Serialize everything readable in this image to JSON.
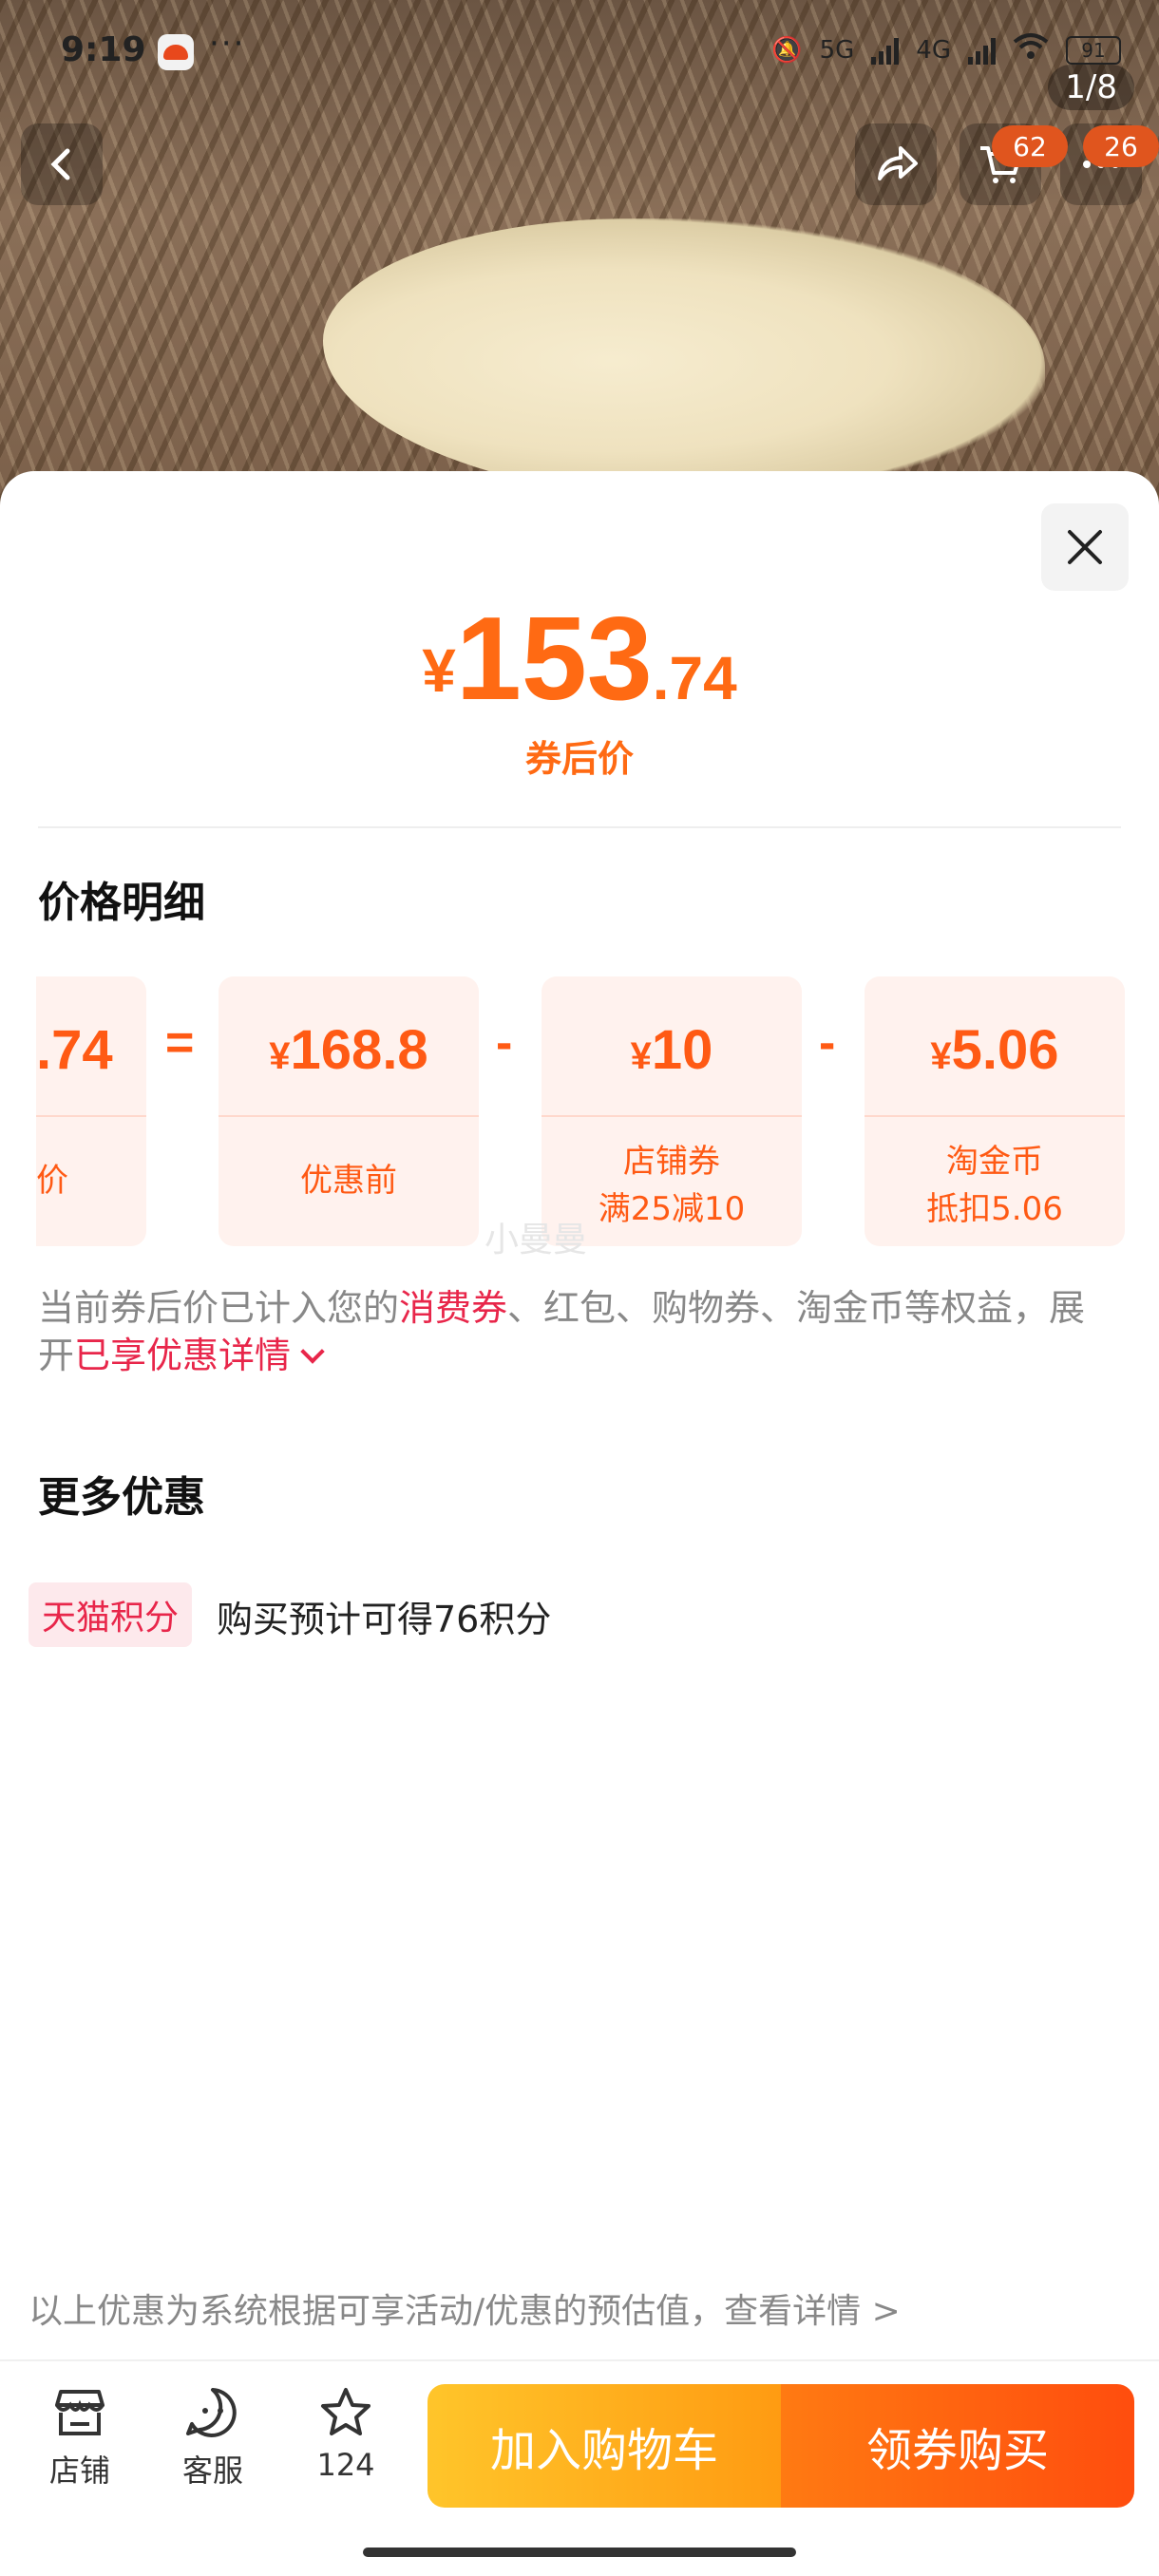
{
  "status_bar": {
    "time": "9:19",
    "more": "···",
    "network_1": "5G",
    "network_2": "4G",
    "battery": "91"
  },
  "hero": {
    "page_indicator": "1/8",
    "cart_count": "62",
    "more_count": "26"
  },
  "price": {
    "currency": "¥",
    "integer": "153",
    "decimal": ".74",
    "label": "券后价"
  },
  "breakdown": {
    "title": "价格明细",
    "result": {
      "amount": ".74",
      "label": "价"
    },
    "equals": "=",
    "minus": "-",
    "items": [
      {
        "currency": "¥",
        "amount": "168.8",
        "label_1": "优惠前",
        "label_2": ""
      },
      {
        "currency": "¥",
        "amount": "10",
        "label_1": "店铺券",
        "label_2": "满25减10"
      },
      {
        "currency": "¥",
        "amount": "5.06",
        "label_1": "淘金币",
        "label_2": "抵扣5.06"
      }
    ],
    "watermark": "小曼曼"
  },
  "note": {
    "prefix": "当前券后价已计入您的",
    "highlight": "消费券",
    "middle": "、红包、购物券、淘金币等权益，展开",
    "link": "已享优惠详情"
  },
  "more": {
    "title": "更多优惠",
    "tag": "天猫积分",
    "text": "购买预计可得76积分"
  },
  "disclaimer": "以上优惠为系统根据可享活动/优惠的预估值，查看详情 >",
  "bottom_nav": {
    "store": "店铺",
    "service": "客服",
    "favorites": "124",
    "add_to_cart": "加入购物车",
    "buy": "领券购买"
  },
  "colors": {
    "accent": "#ff6a13",
    "red": "#e8264a"
  }
}
